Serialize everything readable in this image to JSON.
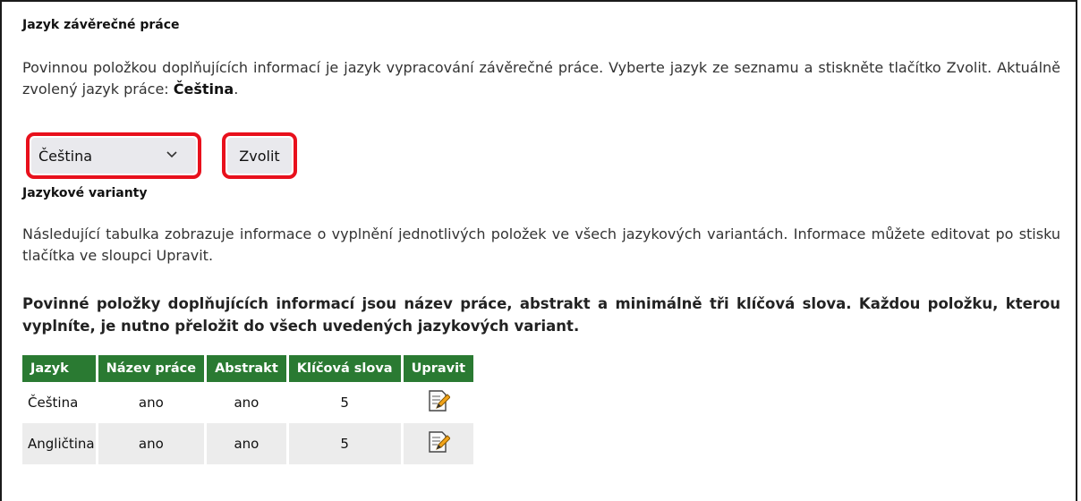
{
  "language_section": {
    "title": "Jazyk závěrečné práce",
    "description_text": "Povinnou položkou doplňujících informací je jazyk vypracování závěrečné práce. Vyberte jazyk ze seznamu a stiskněte tlačítko Zvolit. Aktuálně zvolený jazyk práce: ",
    "current_language": "Čeština",
    "description_end": ".",
    "select_value": "Čeština",
    "submit_label": "Zvolit"
  },
  "variants_section": {
    "title": "Jazykové varianty",
    "description": "Následující tabulka zobrazuje informace o vyplnění jednotlivých položek ve všech jazykových variantách. Informace můžete editovat po stisku tlačítka ve sloupci Upravit.",
    "notice": "Povinné položky doplňujících informací jsou název práce, abstrakt a minimálně tři klíčová slova. Každou položku, kterou vyplníte, je nutno přeložit do všech uvedených jazykových variant."
  },
  "table": {
    "headers": [
      "Jazyk",
      "Název práce",
      "Abstrakt",
      "Klíčová slova",
      "Upravit"
    ],
    "rows": [
      {
        "language": "Čeština",
        "title": "ano",
        "abstract": "ano",
        "keywords": "5",
        "edit_icon": "edit-document-icon"
      },
      {
        "language": "Angličtina",
        "title": "ano",
        "abstract": "ano",
        "keywords": "5",
        "edit_icon": "edit-document-icon"
      }
    ]
  },
  "colors": {
    "header_green": "#2a7a32",
    "highlight_red": "#e8101c"
  }
}
